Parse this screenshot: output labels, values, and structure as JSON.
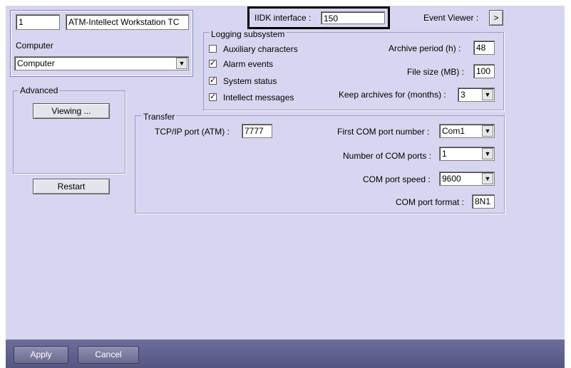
{
  "top": {
    "id_value": "1",
    "name_value": "ATM-Intellect Workstation TC",
    "computer_label": "Computer",
    "computer_select": "Computer"
  },
  "iidk": {
    "label": "IIDK interface :",
    "value": "150"
  },
  "event_viewer": {
    "label": "Event Viewer :",
    "button": ">"
  },
  "advanced": {
    "legend": "Advanced",
    "viewing_button": "Viewing ...",
    "restart_button": "Restart"
  },
  "logging": {
    "legend": "Logging subsystem",
    "checkboxes": [
      {
        "label": "Auxiliary characters",
        "checked": false
      },
      {
        "label": "Alarm events",
        "checked": true
      },
      {
        "label": "System status",
        "checked": true
      },
      {
        "label": "Intellect messages",
        "checked": true
      }
    ],
    "archive_period_label": "Archive period (h) :",
    "archive_period_value": "48",
    "file_size_label": "File size (MB) :",
    "file_size_value": "100",
    "keep_archives_label": "Keep archives for (months) :",
    "keep_archives_value": "3"
  },
  "transfer": {
    "legend": "Transfer",
    "tcp_port_label": "TCP/IP port (ATM) :",
    "tcp_port_value": "7777",
    "first_com_label": "First COM port number :",
    "first_com_value": "Com1",
    "num_com_label": "Number of COM ports :",
    "num_com_value": "1",
    "com_speed_label": "COM port speed :",
    "com_speed_value": "9600",
    "com_format_label": "COM port format :",
    "com_format_value": "8N1"
  },
  "footer": {
    "apply": "Apply",
    "cancel": "Cancel"
  },
  "colors": {
    "panel": "#d7d6f0",
    "highlight_border": "#000000",
    "footer": "#5f5f8c"
  },
  "icons": {
    "dropdown": "chevron-down-icon",
    "check": "check-icon"
  }
}
